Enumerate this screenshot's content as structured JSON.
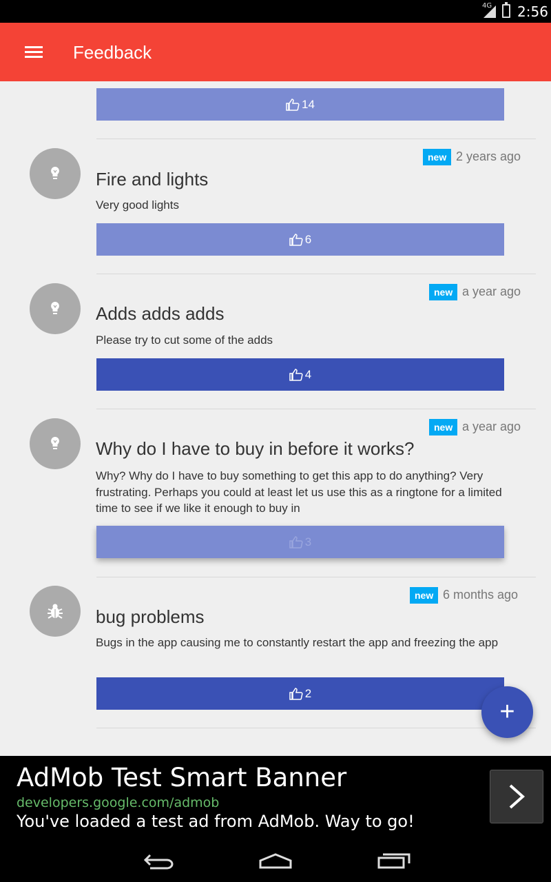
{
  "status_bar": {
    "network": "4G",
    "time": "2:56"
  },
  "app_bar": {
    "title": "Feedback",
    "menu_icon": "menu-icon"
  },
  "feedback": {
    "first_partial": {
      "votes": "14"
    },
    "items": [
      {
        "badge": "new",
        "time_ago": "2 years ago",
        "title": "Fire and lights",
        "body": "Very good lights",
        "votes": "6",
        "icon": "lightbulb-icon"
      },
      {
        "badge": "new",
        "time_ago": "a year ago",
        "title": "Adds adds adds",
        "body": "Please try to cut some of the adds",
        "votes": "4",
        "icon": "lightbulb-icon"
      },
      {
        "badge": "new",
        "time_ago": "a year ago",
        "title": "Why do I have to buy in before it works?",
        "body": "Why? Why do I have to buy something to get this app to do anything? Very frustrating. Perhaps you could at least let us use this as a ringtone for a limited time to see if we like it enough to buy in",
        "votes": "3",
        "icon": "lightbulb-icon"
      },
      {
        "badge": "new",
        "time_ago": "6 months ago",
        "title": "bug problems",
        "body": "Bugs in the app causing me to constantly restart the app and freezing the app",
        "votes": "2",
        "icon": "bug-icon"
      }
    ]
  },
  "fab": {
    "label": "+"
  },
  "ad": {
    "title": "AdMob Test Smart Banner",
    "url": "developers.google.com/admob",
    "description": "You've loaded a test ad from AdMob. Way to go!"
  },
  "colors": {
    "app_bar": "#f44336",
    "vote_light": "#7b8bd2",
    "vote_dark": "#3a51b5",
    "badge": "#03a9f4",
    "fab": "#3a51b5"
  }
}
